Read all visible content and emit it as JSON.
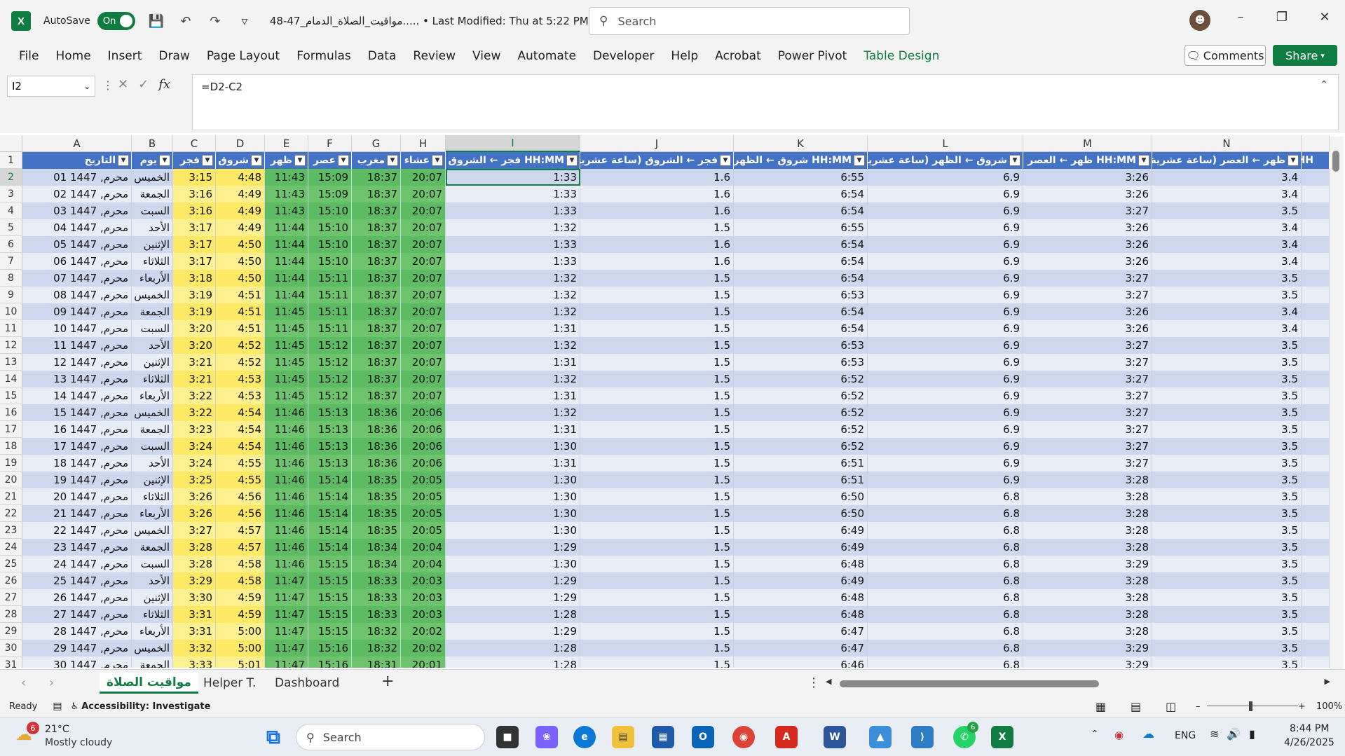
{
  "titlebar": {
    "app_icon": "X",
    "autosave_label": "AutoSave",
    "autosave_state": "On",
    "doc_title": "48-47_مواقيت_الصلاة_الدمام..... • Last Modified: Thu at 5:22 PM",
    "search_placeholder": "Search"
  },
  "menu": [
    "File",
    "Home",
    "Insert",
    "Draw",
    "Page Layout",
    "Formulas",
    "Data",
    "Review",
    "View",
    "Automate",
    "Developer",
    "Help",
    "Acrobat",
    "Power Pivot",
    "Table Design"
  ],
  "comments_label": "Comments",
  "share_label": "Share",
  "formula": {
    "namebox": "I2",
    "fx": "fx",
    "content": "=D2-C2"
  },
  "columns": [
    "A",
    "B",
    "C",
    "D",
    "E",
    "F",
    "G",
    "H",
    "I",
    "J",
    "K",
    "L",
    "M",
    "N"
  ],
  "headers": [
    "التاريخ",
    "يوم",
    "فجر",
    "شروق",
    "ظهر",
    "عصر",
    "مغرب",
    "عشاء",
    "فجر ← الشروق HH:MM",
    "فجر ← الشروق (ساعة عشرية)",
    "شروق ← الظهر HH:MM",
    "شروق ← الظهر (ساعة عشرية)",
    "ظهر ← العصر HH:MM",
    "ظهر ← العصر (ساعة عشرية)",
    "HH"
  ],
  "rows": [
    [
      "01 محرم, 1447",
      "الخميس",
      "3:15",
      "4:48",
      "11:43",
      "15:09",
      "18:37",
      "20:07",
      "1:33",
      "1.6",
      "6:55",
      "6.9",
      "3:26",
      "3.4"
    ],
    [
      "02 محرم, 1447",
      "الجمعة",
      "3:16",
      "4:49",
      "11:43",
      "15:09",
      "18:37",
      "20:07",
      "1:33",
      "1.6",
      "6:54",
      "6.9",
      "3:26",
      "3.4"
    ],
    [
      "03 محرم, 1447",
      "السبت",
      "3:16",
      "4:49",
      "11:43",
      "15:10",
      "18:37",
      "20:07",
      "1:33",
      "1.6",
      "6:54",
      "6.9",
      "3:27",
      "3.5"
    ],
    [
      "04 محرم, 1447",
      "الأحد",
      "3:17",
      "4:49",
      "11:44",
      "15:10",
      "18:37",
      "20:07",
      "1:32",
      "1.5",
      "6:55",
      "6.9",
      "3:26",
      "3.4"
    ],
    [
      "05 محرم, 1447",
      "الإثنين",
      "3:17",
      "4:50",
      "11:44",
      "15:10",
      "18:37",
      "20:07",
      "1:33",
      "1.6",
      "6:54",
      "6.9",
      "3:26",
      "3.4"
    ],
    [
      "06 محرم, 1447",
      "الثلاثاء",
      "3:17",
      "4:50",
      "11:44",
      "15:10",
      "18:37",
      "20:07",
      "1:33",
      "1.6",
      "6:54",
      "6.9",
      "3:26",
      "3.4"
    ],
    [
      "07 محرم, 1447",
      "الأربعاء",
      "3:18",
      "4:50",
      "11:44",
      "15:11",
      "18:37",
      "20:07",
      "1:32",
      "1.5",
      "6:54",
      "6.9",
      "3:27",
      "3.5"
    ],
    [
      "08 محرم, 1447",
      "الخميس",
      "3:19",
      "4:51",
      "11:44",
      "15:11",
      "18:37",
      "20:07",
      "1:32",
      "1.5",
      "6:53",
      "6.9",
      "3:27",
      "3.5"
    ],
    [
      "09 محرم, 1447",
      "الجمعة",
      "3:19",
      "4:51",
      "11:45",
      "15:11",
      "18:37",
      "20:07",
      "1:32",
      "1.5",
      "6:54",
      "6.9",
      "3:26",
      "3.4"
    ],
    [
      "10 محرم, 1447",
      "السبت",
      "3:20",
      "4:51",
      "11:45",
      "15:11",
      "18:37",
      "20:07",
      "1:31",
      "1.5",
      "6:54",
      "6.9",
      "3:26",
      "3.4"
    ],
    [
      "11 محرم, 1447",
      "الأحد",
      "3:20",
      "4:52",
      "11:45",
      "15:12",
      "18:37",
      "20:07",
      "1:32",
      "1.5",
      "6:53",
      "6.9",
      "3:27",
      "3.5"
    ],
    [
      "12 محرم, 1447",
      "الإثنين",
      "3:21",
      "4:52",
      "11:45",
      "15:12",
      "18:37",
      "20:07",
      "1:31",
      "1.5",
      "6:53",
      "6.9",
      "3:27",
      "3.5"
    ],
    [
      "13 محرم, 1447",
      "الثلاثاء",
      "3:21",
      "4:53",
      "11:45",
      "15:12",
      "18:37",
      "20:07",
      "1:32",
      "1.5",
      "6:52",
      "6.9",
      "3:27",
      "3.5"
    ],
    [
      "14 محرم, 1447",
      "الأربعاء",
      "3:22",
      "4:53",
      "11:45",
      "15:12",
      "18:37",
      "20:07",
      "1:31",
      "1.5",
      "6:52",
      "6.9",
      "3:27",
      "3.5"
    ],
    [
      "15 محرم, 1447",
      "الخميس",
      "3:22",
      "4:54",
      "11:46",
      "15:13",
      "18:36",
      "20:06",
      "1:32",
      "1.5",
      "6:52",
      "6.9",
      "3:27",
      "3.5"
    ],
    [
      "16 محرم, 1447",
      "الجمعة",
      "3:23",
      "4:54",
      "11:46",
      "15:13",
      "18:36",
      "20:06",
      "1:31",
      "1.5",
      "6:52",
      "6.9",
      "3:27",
      "3.5"
    ],
    [
      "17 محرم, 1447",
      "السبت",
      "3:24",
      "4:54",
      "11:46",
      "15:13",
      "18:36",
      "20:06",
      "1:30",
      "1.5",
      "6:52",
      "6.9",
      "3:27",
      "3.5"
    ],
    [
      "18 محرم, 1447",
      "الأحد",
      "3:24",
      "4:55",
      "11:46",
      "15:13",
      "18:36",
      "20:06",
      "1:31",
      "1.5",
      "6:51",
      "6.9",
      "3:27",
      "3.5"
    ],
    [
      "19 محرم, 1447",
      "الإثنين",
      "3:25",
      "4:55",
      "11:46",
      "15:14",
      "18:35",
      "20:05",
      "1:30",
      "1.5",
      "6:51",
      "6.9",
      "3:28",
      "3.5"
    ],
    [
      "20 محرم, 1447",
      "الثلاثاء",
      "3:26",
      "4:56",
      "11:46",
      "15:14",
      "18:35",
      "20:05",
      "1:30",
      "1.5",
      "6:50",
      "6.8",
      "3:28",
      "3.5"
    ],
    [
      "21 محرم, 1447",
      "الأربعاء",
      "3:26",
      "4:56",
      "11:46",
      "15:14",
      "18:35",
      "20:05",
      "1:30",
      "1.5",
      "6:50",
      "6.8",
      "3:28",
      "3.5"
    ],
    [
      "22 محرم, 1447",
      "الخميس",
      "3:27",
      "4:57",
      "11:46",
      "15:14",
      "18:35",
      "20:05",
      "1:30",
      "1.5",
      "6:49",
      "6.8",
      "3:28",
      "3.5"
    ],
    [
      "23 محرم, 1447",
      "الجمعة",
      "3:28",
      "4:57",
      "11:46",
      "15:14",
      "18:34",
      "20:04",
      "1:29",
      "1.5",
      "6:49",
      "6.8",
      "3:28",
      "3.5"
    ],
    [
      "24 محرم, 1447",
      "السبت",
      "3:28",
      "4:58",
      "11:46",
      "15:15",
      "18:34",
      "20:04",
      "1:30",
      "1.5",
      "6:48",
      "6.8",
      "3:29",
      "3.5"
    ],
    [
      "25 محرم, 1447",
      "الأحد",
      "3:29",
      "4:58",
      "11:47",
      "15:15",
      "18:33",
      "20:03",
      "1:29",
      "1.5",
      "6:49",
      "6.8",
      "3:28",
      "3.5"
    ],
    [
      "26 محرم, 1447",
      "الإثنين",
      "3:30",
      "4:59",
      "11:47",
      "15:15",
      "18:33",
      "20:03",
      "1:29",
      "1.5",
      "6:48",
      "6.8",
      "3:28",
      "3.5"
    ],
    [
      "27 محرم, 1447",
      "الثلاثاء",
      "3:31",
      "4:59",
      "11:47",
      "15:15",
      "18:33",
      "20:03",
      "1:28",
      "1.5",
      "6:48",
      "6.8",
      "3:28",
      "3.5"
    ],
    [
      "28 محرم, 1447",
      "الأربعاء",
      "3:31",
      "5:00",
      "11:47",
      "15:15",
      "18:32",
      "20:02",
      "1:29",
      "1.5",
      "6:47",
      "6.8",
      "3:28",
      "3.5"
    ],
    [
      "29 محرم, 1447",
      "الخميس",
      "3:32",
      "5:00",
      "11:47",
      "15:16",
      "18:32",
      "20:02",
      "1:28",
      "1.5",
      "6:47",
      "6.8",
      "3:29",
      "3.5"
    ],
    [
      "30 محرم, 1447",
      "الجمعة",
      "3:33",
      "5:01",
      "11:47",
      "15:16",
      "18:31",
      "20:01",
      "1:28",
      "1.5",
      "6:46",
      "6.8",
      "3:29",
      "3.5"
    ]
  ],
  "sheets": [
    "مواقيت الصلاة",
    "Helper T.",
    "Dashboard"
  ],
  "status": {
    "ready": "Ready",
    "accessibility": "Accessibility: Investigate",
    "zoom": "100%"
  },
  "taskbar": {
    "weather_temp": "21°C",
    "weather_desc": "Mostly cloudy",
    "weather_badge": "6",
    "search": "Search",
    "lang": "ENG",
    "time": "8:44 PM",
    "date": "4/26/2025",
    "whatsapp_badge": "6"
  },
  "colors": {
    "accent": "#107c41",
    "table_header": "#4472c4",
    "band_a": "#cdd8ee",
    "band_b": "#e8edf7",
    "fajr": "#fde965",
    "asr": "#5dbb63"
  }
}
